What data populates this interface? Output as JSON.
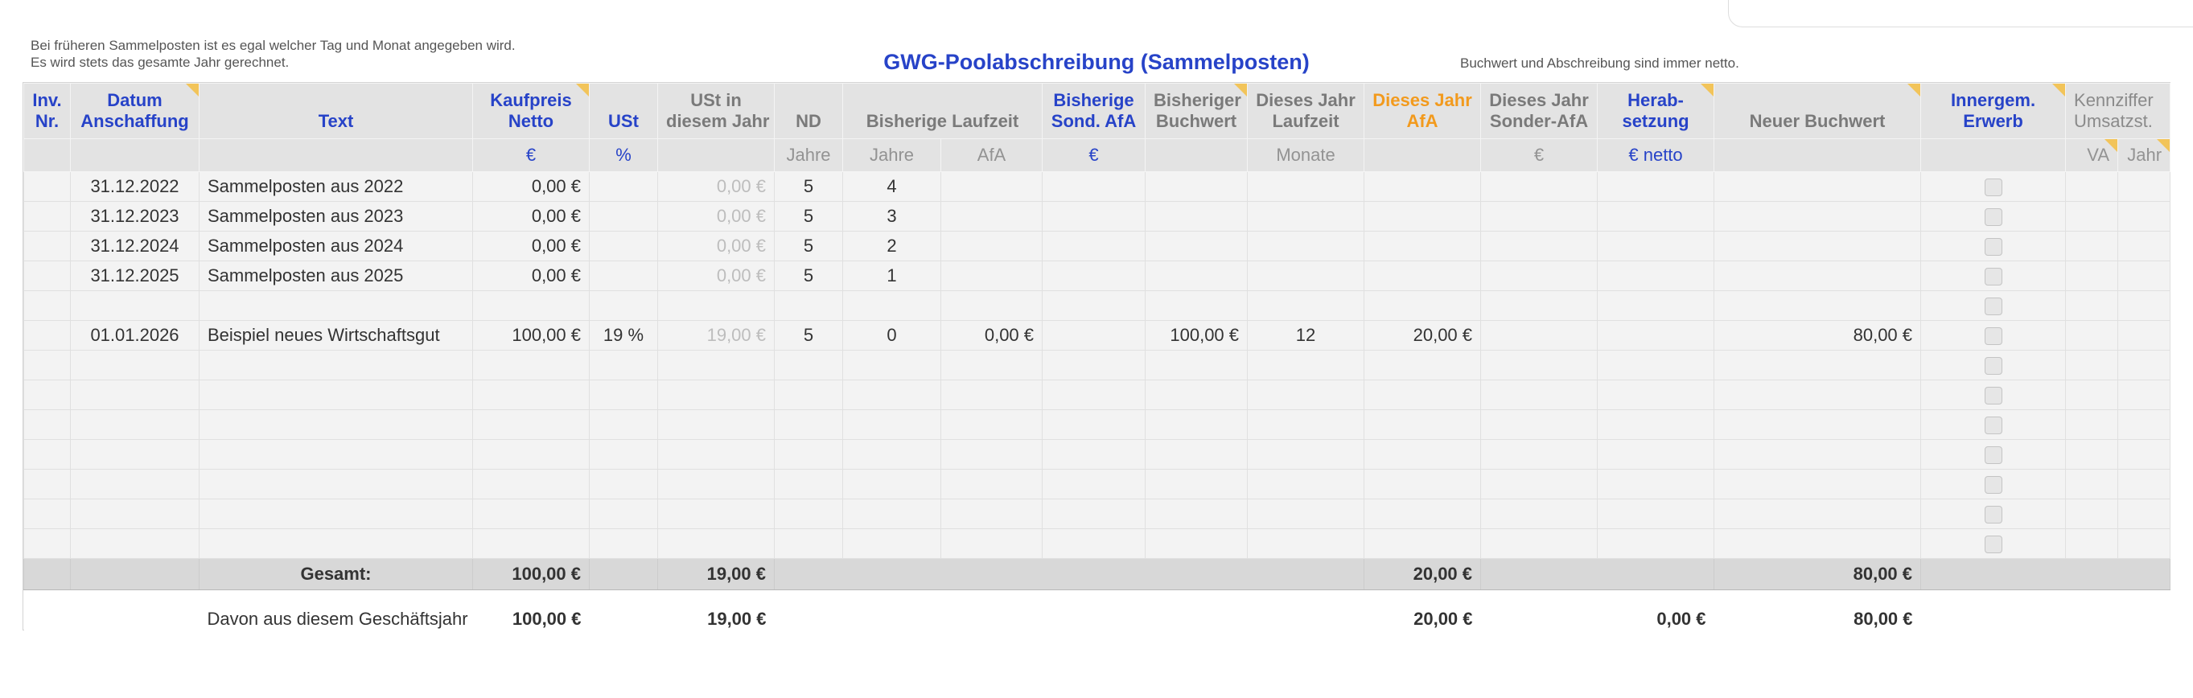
{
  "notes": {
    "left_line1": "Bei früheren Sammelposten ist es egal welcher Tag und Monat angegeben wird.",
    "left_line2": "Es wird stets das gesamte Jahr gerechnet.",
    "right": "Buchwert und Abschreibung sind immer netto."
  },
  "title": "GWG-Poolabschreibung (Sammelposten)",
  "colors": {
    "accent_blue": "#2743c8",
    "accent_orange": "#f29a1d",
    "header_bg": "#e3e3e3",
    "row_bg": "#f3f3f3"
  },
  "headers": {
    "inv_l1": "Inv.",
    "inv_l2": "Nr.",
    "datum_l1": "Datum",
    "datum_l2": "Anschaffung",
    "text": "Text",
    "kaufpreis_l1": "Kaufpreis",
    "kaufpreis_l2": "Netto",
    "ust": "USt",
    "ust_jahr_l1": "USt in",
    "ust_jahr_l2": "diesem Jahr",
    "nd": "ND",
    "bisherige_laufzeit": "Bisherige Laufzeit",
    "sond_afa_l1": "Bisherige",
    "sond_afa_l2": "Sond. AfA",
    "buchwert_l1": "Bisheriger",
    "buchwert_l2": "Buchwert",
    "laufzeit_l1": "Dieses Jahr",
    "laufzeit_l2": "Laufzeit",
    "afa_l1": "Dieses Jahr",
    "afa_l2": "AfA",
    "sonder_afa_l1": "Dieses Jahr",
    "sonder_afa_l2": "Sonder-AfA",
    "herab_l1": "Herab-",
    "herab_l2": "setzung",
    "neuer_buchwert": "Neuer Buchwert",
    "innergem_l1": "Innergem.",
    "innergem_l2": "Erwerb",
    "kennziffer_l1": "Kennziffer",
    "kennziffer_l2": "Umsatzst."
  },
  "units": {
    "kaufpreis": "€",
    "ust": "%",
    "nd": "Jahre",
    "jahre": "Jahre",
    "afa": "AfA",
    "sond_afa": "€",
    "monate": "Monate",
    "sonder_afa": "€",
    "herab": "€  netto",
    "va": "VA",
    "jahr": "Jahr"
  },
  "rows": [
    {
      "datum": "31.12.2022",
      "text": "Sammelposten aus 2022",
      "kaufpreis": "0,00 €",
      "ust": "",
      "ust_jahr": "0,00 €",
      "nd": "5",
      "jahre": "4",
      "afa_bisher": "",
      "buchwert": "",
      "laufzeit": "",
      "afa": "",
      "neuer_buchwert": ""
    },
    {
      "datum": "31.12.2023",
      "text": "Sammelposten aus 2023",
      "kaufpreis": "0,00 €",
      "ust": "",
      "ust_jahr": "0,00 €",
      "nd": "5",
      "jahre": "3",
      "afa_bisher": "",
      "buchwert": "",
      "laufzeit": "",
      "afa": "",
      "neuer_buchwert": ""
    },
    {
      "datum": "31.12.2024",
      "text": "Sammelposten aus 2024",
      "kaufpreis": "0,00 €",
      "ust": "",
      "ust_jahr": "0,00 €",
      "nd": "5",
      "jahre": "2",
      "afa_bisher": "",
      "buchwert": "",
      "laufzeit": "",
      "afa": "",
      "neuer_buchwert": ""
    },
    {
      "datum": "31.12.2025",
      "text": "Sammelposten aus 2025",
      "kaufpreis": "0,00 €",
      "ust": "",
      "ust_jahr": "0,00 €",
      "nd": "5",
      "jahre": "1",
      "afa_bisher": "",
      "buchwert": "",
      "laufzeit": "",
      "afa": "",
      "neuer_buchwert": ""
    },
    {
      "datum": "",
      "text": "",
      "kaufpreis": "",
      "ust": "",
      "ust_jahr": "",
      "nd": "",
      "jahre": "",
      "afa_bisher": "",
      "buchwert": "",
      "laufzeit": "",
      "afa": "",
      "neuer_buchwert": ""
    },
    {
      "datum": "01.01.2026",
      "text": "Beispiel neues Wirtschaftsgut",
      "kaufpreis": "100,00 €",
      "ust": "19 %",
      "ust_jahr": "19,00 €",
      "nd": "5",
      "jahre": "0",
      "afa_bisher": "0,00 €",
      "buchwert": "100,00 €",
      "laufzeit": "12",
      "afa": "20,00 €",
      "neuer_buchwert": "80,00 €"
    },
    {
      "datum": "",
      "text": "",
      "kaufpreis": "",
      "ust": "",
      "ust_jahr": "",
      "nd": "",
      "jahre": "",
      "afa_bisher": "",
      "buchwert": "",
      "laufzeit": "",
      "afa": "",
      "neuer_buchwert": ""
    },
    {
      "datum": "",
      "text": "",
      "kaufpreis": "",
      "ust": "",
      "ust_jahr": "",
      "nd": "",
      "jahre": "",
      "afa_bisher": "",
      "buchwert": "",
      "laufzeit": "",
      "afa": "",
      "neuer_buchwert": ""
    },
    {
      "datum": "",
      "text": "",
      "kaufpreis": "",
      "ust": "",
      "ust_jahr": "",
      "nd": "",
      "jahre": "",
      "afa_bisher": "",
      "buchwert": "",
      "laufzeit": "",
      "afa": "",
      "neuer_buchwert": ""
    },
    {
      "datum": "",
      "text": "",
      "kaufpreis": "",
      "ust": "",
      "ust_jahr": "",
      "nd": "",
      "jahre": "",
      "afa_bisher": "",
      "buchwert": "",
      "laufzeit": "",
      "afa": "",
      "neuer_buchwert": ""
    },
    {
      "datum": "",
      "text": "",
      "kaufpreis": "",
      "ust": "",
      "ust_jahr": "",
      "nd": "",
      "jahre": "",
      "afa_bisher": "",
      "buchwert": "",
      "laufzeit": "",
      "afa": "",
      "neuer_buchwert": ""
    },
    {
      "datum": "",
      "text": "",
      "kaufpreis": "",
      "ust": "",
      "ust_jahr": "",
      "nd": "",
      "jahre": "",
      "afa_bisher": "",
      "buchwert": "",
      "laufzeit": "",
      "afa": "",
      "neuer_buchwert": ""
    },
    {
      "datum": "",
      "text": "",
      "kaufpreis": "",
      "ust": "",
      "ust_jahr": "",
      "nd": "",
      "jahre": "",
      "afa_bisher": "",
      "buchwert": "",
      "laufzeit": "",
      "afa": "",
      "neuer_buchwert": ""
    }
  ],
  "totals": {
    "label": "Gesamt:",
    "kaufpreis": "100,00 €",
    "ust_jahr": "19,00 €",
    "afa": "20,00 €",
    "neuer_buchwert": "80,00 €"
  },
  "fiscal_year": {
    "label": "Davon aus diesem Geschäftsjahr",
    "kaufpreis": "100,00 €",
    "ust_jahr": "19,00 €",
    "afa": "20,00 €",
    "herab": "0,00 €",
    "neuer_buchwert": "80,00 €"
  }
}
